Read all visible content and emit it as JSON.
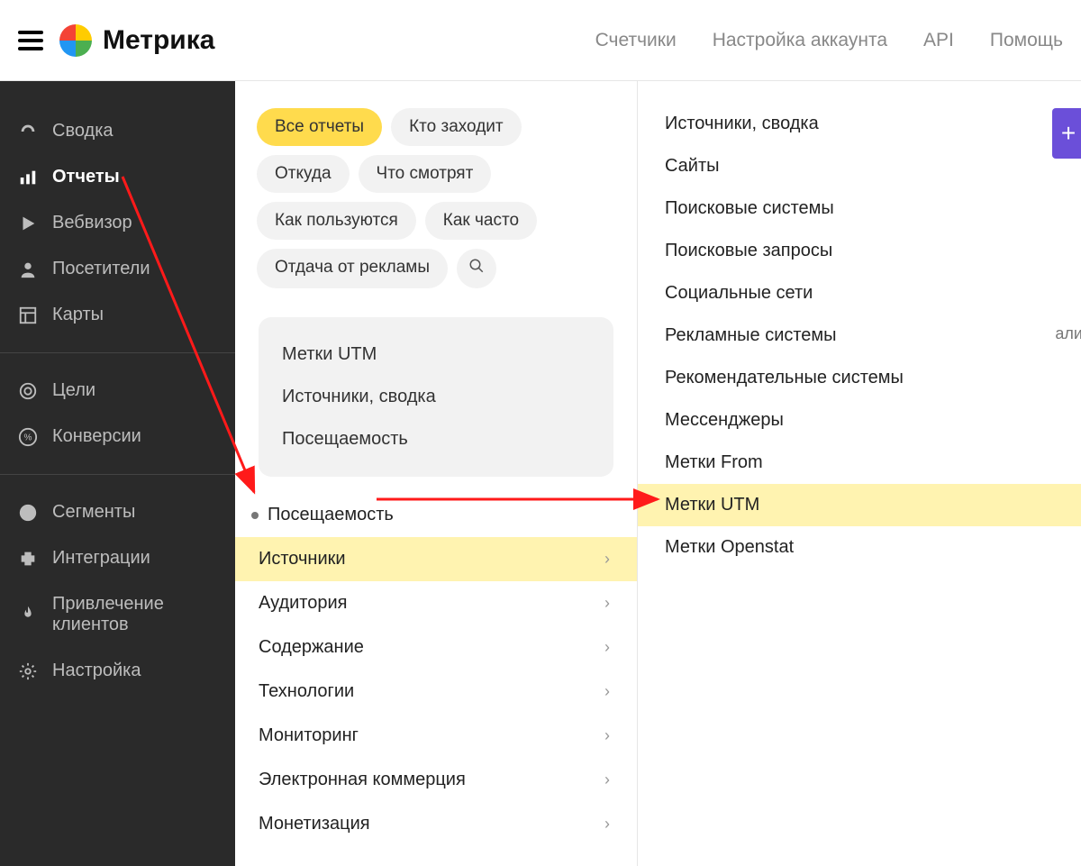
{
  "app_title": "Метрика",
  "topnav": [
    "Счетчики",
    "Настройка аккаунта",
    "API",
    "Помощь"
  ],
  "sidebar": {
    "group1": [
      {
        "id": "svodka",
        "label": "Сводка"
      },
      {
        "id": "reports",
        "label": "Отчеты",
        "active": true
      },
      {
        "id": "webvisor",
        "label": "Вебвизор"
      },
      {
        "id": "visitors",
        "label": "Посетители"
      },
      {
        "id": "maps",
        "label": "Карты"
      }
    ],
    "group2": [
      {
        "id": "goals",
        "label": "Цели"
      },
      {
        "id": "conversions",
        "label": "Конверсии"
      }
    ],
    "group3": [
      {
        "id": "segments",
        "label": "Сегменты"
      },
      {
        "id": "integrations",
        "label": "Интеграции"
      },
      {
        "id": "acquisition",
        "label": "Привлечение клиентов"
      },
      {
        "id": "settings",
        "label": "Настройка"
      }
    ]
  },
  "filters": {
    "chips": [
      "Все отчеты",
      "Кто заходит",
      "Откуда",
      "Что смотрят",
      "Как пользуются",
      "Как часто",
      "Отдача от рекламы"
    ],
    "active_index": 0
  },
  "recent": [
    "Метки UTM",
    "Источники, сводка",
    "Посещаемость"
  ],
  "categories_plain": "Посещаемость",
  "categories": [
    {
      "label": "Источники",
      "highlight": true
    },
    {
      "label": "Аудитория"
    },
    {
      "label": "Содержание"
    },
    {
      "label": "Технологии"
    },
    {
      "label": "Мониторинг"
    },
    {
      "label": "Электронная коммерция"
    },
    {
      "label": "Монетизация"
    }
  ],
  "right_panel": [
    {
      "label": "Источники, сводка"
    },
    {
      "label": "Сайты"
    },
    {
      "label": "Поисковые системы"
    },
    {
      "label": "Поисковые запросы"
    },
    {
      "label": "Социальные сети"
    },
    {
      "label": "Рекламные системы"
    },
    {
      "label": "Рекомендательные системы"
    },
    {
      "label": "Мессенджеры"
    },
    {
      "label": "Метки From"
    },
    {
      "label": "Метки UTM",
      "highlight": true
    },
    {
      "label": "Метки Openstat"
    }
  ],
  "stray_text": "али",
  "add_button": "+"
}
